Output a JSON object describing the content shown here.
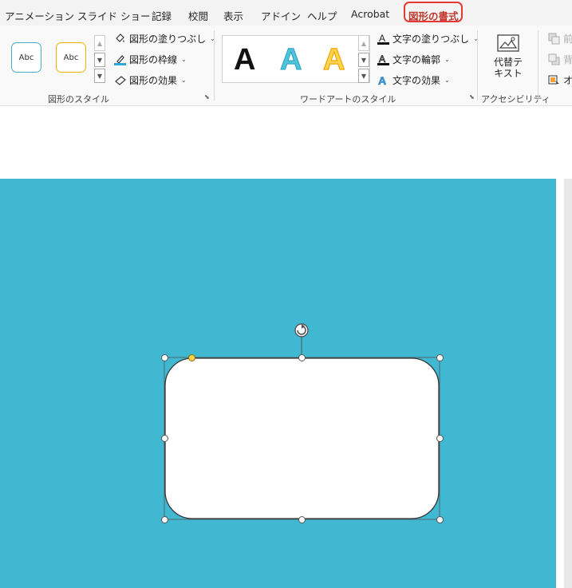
{
  "tabs": [
    {
      "label": "アニメーション"
    },
    {
      "label": "スライド ショー"
    },
    {
      "label": "記録"
    },
    {
      "label": "校閲"
    },
    {
      "label": "表示"
    },
    {
      "label": "アドイン"
    },
    {
      "label": "ヘルプ"
    },
    {
      "label": "Acrobat"
    },
    {
      "label": "図形の書式",
      "active": true
    }
  ],
  "shape_styles": {
    "gallery": [
      {
        "label": "Abc",
        "border_color": "#4bacc6"
      },
      {
        "label": "Abc",
        "border_color": "#f0b400"
      }
    ],
    "commands": {
      "fill": "図形の塗りつぶし",
      "outline": "図形の枠線",
      "effects": "図形の効果"
    },
    "group_label": "図形のスタイル"
  },
  "wordart": {
    "gallery": [
      {
        "letter": "A",
        "style": "black"
      },
      {
        "letter": "A",
        "style": "blue"
      },
      {
        "letter": "A",
        "style": "gold"
      }
    ],
    "commands": {
      "text_fill": "文字の塗りつぶし",
      "text_outline": "文字の輪郭",
      "text_effects": "文字の効果"
    },
    "group_label": "ワードアートのスタイル"
  },
  "accessibility": {
    "alt_text_line1": "代替テ",
    "alt_text_line2": "キスト",
    "group_label": "アクセシビリティ"
  },
  "arrange": {
    "partial": [
      "前",
      "背",
      "オ"
    ]
  },
  "colors": {
    "slide_background": "#40b8d2",
    "active_tab": "#c0392b",
    "tab_outline": "#e53935"
  },
  "shape": {
    "type": "rounded-rectangle",
    "fill": "#ffffff",
    "selected": true
  }
}
